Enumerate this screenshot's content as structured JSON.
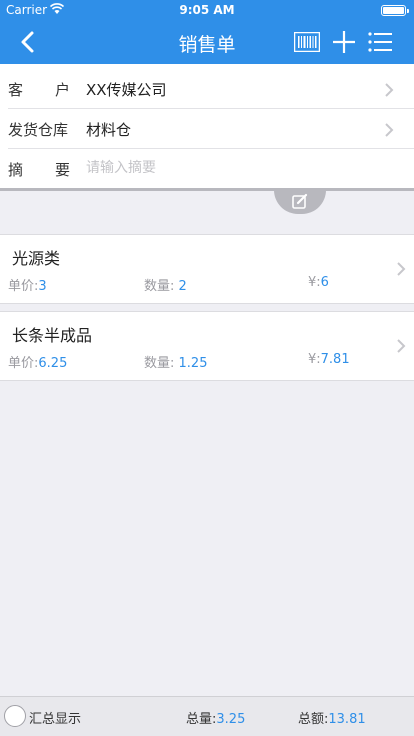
{
  "status_bar": {
    "carrier": "Carrier",
    "time": "9:05 AM",
    "battery_level": 1.0
  },
  "nav": {
    "title": "销售单",
    "icons": [
      "back-chevron-icon",
      "barcode-icon",
      "plus-icon",
      "menu-list-icon"
    ]
  },
  "form": {
    "customer": {
      "label": "客户",
      "value": "XX传媒公司"
    },
    "warehouse": {
      "label": "发货仓库",
      "value": "材料仓"
    },
    "summary": {
      "label": "摘要",
      "placeholder": "请输入摘要",
      "value": ""
    }
  },
  "items": [
    {
      "name": "光源类",
      "price_label": "单价:",
      "price": "3",
      "qty_label": "数量:",
      "qty": "2",
      "amount_label": "¥:",
      "amount": "6"
    },
    {
      "name": "长条半成品",
      "price_label": "单价:",
      "price": "6.25",
      "qty_label": "数量:",
      "qty": "1.25",
      "amount_label": "¥:",
      "amount": "7.81"
    }
  ],
  "footer": {
    "summary_toggle": "汇总显示",
    "total_qty_label": "总量:",
    "total_qty": "3.25",
    "total_amount_label": "总额:",
    "total_amount": "13.81"
  },
  "colors": {
    "accent": "#2f8fe8",
    "value_blue": "#2f8fe8",
    "background": "#efeff4"
  }
}
